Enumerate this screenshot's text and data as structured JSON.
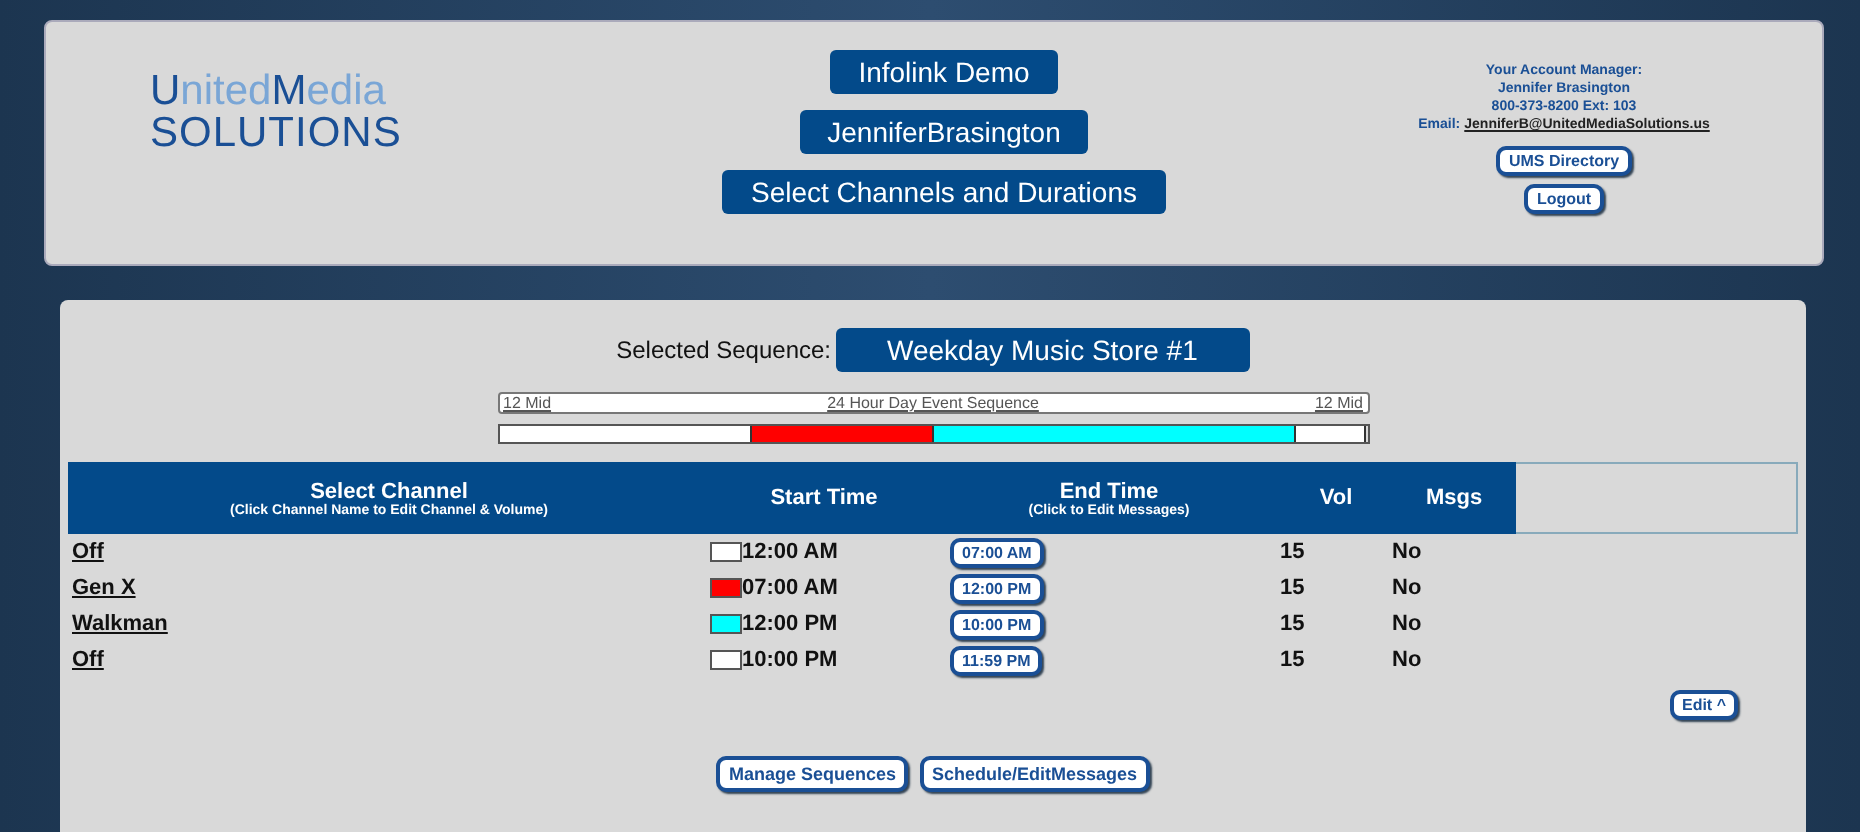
{
  "logo": {
    "line1": [
      {
        "text": "U",
        "strong": true
      },
      {
        "text": "nited",
        "strong": false
      },
      {
        "text": "M",
        "strong": true
      },
      {
        "text": "edia",
        "strong": false
      }
    ],
    "line2": "SOLUTIONS"
  },
  "header_buttons": [
    "Infolink Demo",
    "JenniferBrasington",
    "Select Channels and Durations"
  ],
  "account": {
    "heading": "Your Account Manager:",
    "name": "Jennifer Brasington",
    "phone": "800-373-8200 Ext: 103",
    "email_label": "Email:",
    "email": "JenniferB@UnitedMediaSolutions.us",
    "buttons": [
      "UMS Directory",
      "Logout"
    ]
  },
  "sequence": {
    "label": "Selected Sequence:",
    "value": "Weekday Music Store #1"
  },
  "timeline": {
    "start_label": "12 Mid",
    "title": "24 Hour Day Event Sequence",
    "end_label": "12 Mid"
  },
  "table": {
    "columns": [
      {
        "title": "Select Channel",
        "subtitle": "(Click Channel Name to Edit Channel & Volume)"
      },
      {
        "title": "Start Time"
      },
      {
        "title": "End Time",
        "subtitle": "(Click to Edit Messages)"
      },
      {
        "title": "Vol"
      },
      {
        "title": "Msgs"
      }
    ],
    "rows": [
      {
        "channel": "Off",
        "color": "#ffffff",
        "start": "12:00 AM",
        "end": "07:00 AM",
        "vol": "15",
        "msgs": "No"
      },
      {
        "channel": "Gen X",
        "color": "#ff0000",
        "start": "07:00 AM",
        "end": "12:00 PM",
        "vol": "15",
        "msgs": "No"
      },
      {
        "channel": "Walkman",
        "color": "#00ffff",
        "start": "12:00 PM",
        "end": "10:00 PM",
        "vol": "15",
        "msgs": "No"
      },
      {
        "channel": "Off",
        "color": "#ffffff",
        "start": "10:00 PM",
        "end": "11:59 PM",
        "vol": "15",
        "msgs": "No"
      }
    ]
  },
  "edit_button": "Edit ^",
  "footer_buttons": [
    "Manage Sequences",
    "Schedule/EditMessages"
  ]
}
